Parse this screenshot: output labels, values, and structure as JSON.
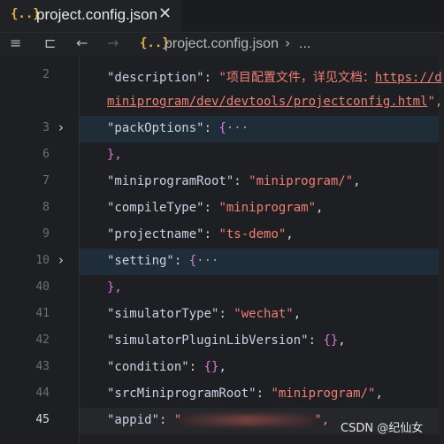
{
  "tab": {
    "icon": "{..}",
    "title": "project.config.json",
    "close": "✕"
  },
  "toolbar": {
    "list_icon": "≡",
    "bookmark_icon": "⊏",
    "back_icon": "←",
    "forward_icon": "→",
    "crumb_icon": "{..}",
    "crumb_label": "project.config.json",
    "crumb_sep": "›",
    "crumb_more": "..."
  },
  "lines": [
    {
      "n": "2",
      "key": "\"description\"",
      "colon": ": ",
      "str": "\"项目配置文件，详见文档：",
      "url": "https://d"
    },
    {
      "n": "",
      "url2": "miniprogram/dev/devtools/projectconfig.html",
      "tail": "\","
    },
    {
      "n": "3",
      "key": "\"packOptions\"",
      "colon": ": ",
      "brace": "{",
      "ell": "···"
    },
    {
      "n": "6",
      "close": "},"
    },
    {
      "n": "7",
      "key": "\"miniprogramRoot\"",
      "colon": ": ",
      "val": "\"miniprogram/\"",
      "comma": ","
    },
    {
      "n": "8",
      "key": "\"compileType\"",
      "colon": ": ",
      "val": "\"miniprogram\"",
      "comma": ","
    },
    {
      "n": "9",
      "key": "\"projectname\"",
      "colon": ": ",
      "val": "\"ts-demo\"",
      "comma": ","
    },
    {
      "n": "10",
      "key": "\"setting\"",
      "colon": ": ",
      "brace": "{",
      "ell": "···"
    },
    {
      "n": "40",
      "close": "},"
    },
    {
      "n": "41",
      "key": "\"simulatorType\"",
      "colon": ": ",
      "val": "\"wechat\"",
      "comma": ","
    },
    {
      "n": "42",
      "key": "\"simulatorPluginLibVersion\"",
      "colon": ": ",
      "obj": "{}",
      "comma": ","
    },
    {
      "n": "43",
      "key": "\"condition\"",
      "colon": ": ",
      "obj": "{}",
      "comma": ","
    },
    {
      "n": "44",
      "key": "\"srcMiniprogramRoot\"",
      "colon": ": ",
      "val": "\"miniprogram/\"",
      "comma": ","
    },
    {
      "n": "45",
      "key": "\"appid\"",
      "colon": ": ",
      "val": "\"",
      "comma": "\","
    }
  ],
  "watermark": "CSDN @纪仙女"
}
